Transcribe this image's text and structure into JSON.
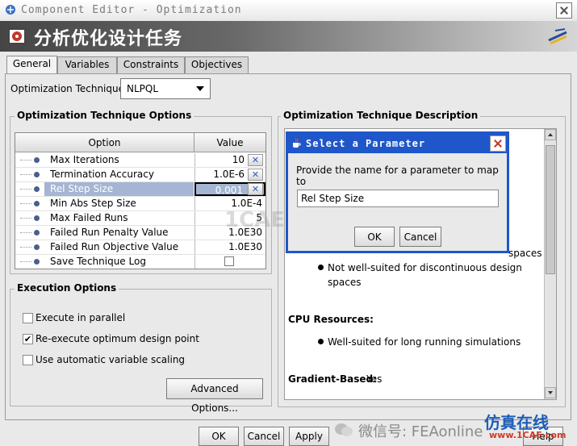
{
  "window": {
    "title": "Component Editor - Optimization",
    "header_title": "分析优化设计任务"
  },
  "tabs": [
    {
      "label": "General",
      "active": true
    },
    {
      "label": "Variables",
      "active": false
    },
    {
      "label": "Constraints",
      "active": false
    },
    {
      "label": "Objectives",
      "active": false
    }
  ],
  "technique": {
    "label": "Optimization Technique:",
    "value": "NLPQL"
  },
  "options": {
    "group_title": "Optimization Technique Options",
    "col_option": "Option",
    "col_value": "Value",
    "rows": [
      {
        "name": "Max Iterations",
        "value": "10",
        "has_button": true
      },
      {
        "name": "Termination Accuracy",
        "value": "1.0E-6",
        "has_button": true
      },
      {
        "name": "Rel Step Size",
        "value": "0.001",
        "has_button": true,
        "selected": true
      },
      {
        "name": "Min Abs Step Size",
        "value": "1.0E-4"
      },
      {
        "name": "Max Failed Runs",
        "value": "5"
      },
      {
        "name": "Failed Run Penalty Value",
        "value": "1.0E30"
      },
      {
        "name": "Failed Run Objective Value",
        "value": "1.0E30"
      },
      {
        "name": "Save Technique Log",
        "value": ""
      }
    ]
  },
  "execution": {
    "group_title": "Execution Options",
    "execute_parallel": "Execute in parallel",
    "reexecute": "Re-execute optimum design point",
    "auto_scaling": "Use automatic variable scaling",
    "advanced_button": "Advanced Options..."
  },
  "description": {
    "group_title": "Optimization Technique Description",
    "partial_spaces": "spaces",
    "bullet1": "Not well-suited for discontinuous design",
    "bullet1_cont": "spaces",
    "cpu_heading": "CPU Resources:",
    "bullet2": "Well-suited for long running simulations",
    "gradient_label": "Gradient-Based:",
    "gradient_value": "Yes"
  },
  "dialog": {
    "title": "Select a Parameter",
    "prompt": "Provide the name for a parameter to map to",
    "field_value": "Rel Step Size",
    "ok": "OK",
    "cancel": "Cancel"
  },
  "footer": {
    "ok": "OK",
    "cancel": "Cancel",
    "apply": "Apply",
    "help": "Help"
  },
  "watermarks": {
    "center": "1CAE.COM",
    "wechat": "微信号: FEAonline",
    "corner_top": "仿真在线",
    "corner_bottom": "www.1CAE.com"
  },
  "colors": {
    "dialog_accent": "#1f56c9",
    "selection": "#a5b5d3"
  }
}
